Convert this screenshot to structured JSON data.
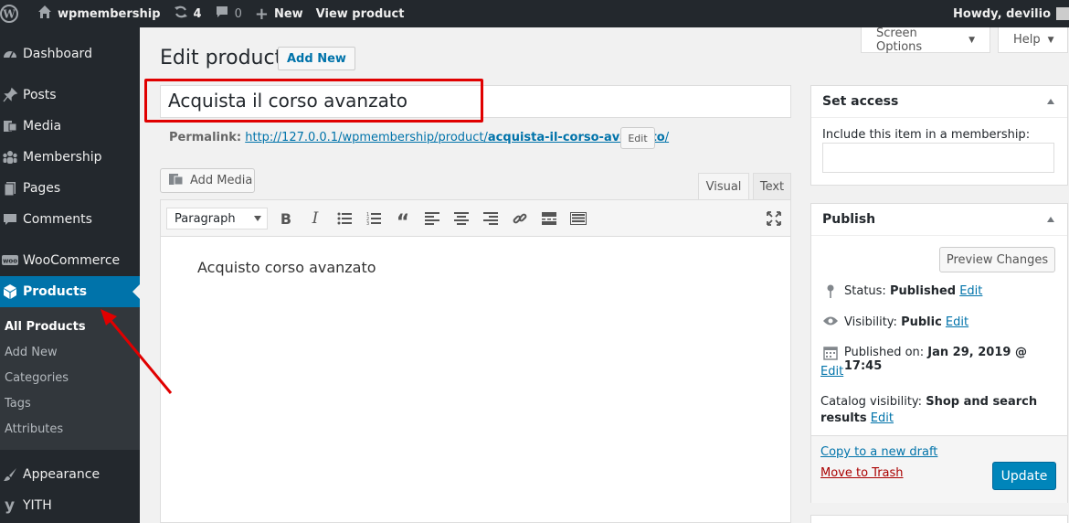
{
  "adminbar": {
    "site_name": "wpmembership",
    "updates_count": "4",
    "comments_count": "0",
    "new_label": "New",
    "view_label": "View product",
    "howdy": "Howdy, devilio"
  },
  "sidebar": {
    "items": [
      {
        "label": "Dashboard",
        "icon": "dashboard-icon"
      },
      {
        "label": "Posts",
        "icon": "pushpin-icon"
      },
      {
        "label": "Media",
        "icon": "media-icon"
      },
      {
        "label": "Membership",
        "icon": "groups-icon"
      },
      {
        "label": "Pages",
        "icon": "pages-icon"
      },
      {
        "label": "Comments",
        "icon": "comment-icon"
      },
      {
        "label": "WooCommerce",
        "icon": "woo-icon"
      },
      {
        "label": "Products",
        "icon": "box-icon"
      },
      {
        "label": "Appearance",
        "icon": "brush-icon"
      },
      {
        "label": "YITH",
        "icon": "yith-icon"
      }
    ],
    "submenu": [
      "All Products",
      "Add New",
      "Categories",
      "Tags",
      "Attributes"
    ]
  },
  "header": {
    "title": "Edit product",
    "add_new": "Add New",
    "screen_options": "Screen Options",
    "help": "Help"
  },
  "editor": {
    "post_title": "Acquista il corso avanzato",
    "permalink_label": "Permalink:",
    "permalink_base": "http://127.0.0.1/wpmembership/product/",
    "permalink_slug": "acquista-il-corso-avanzato",
    "permalink_end": "/",
    "permalink_edit": "Edit",
    "add_media": "Add Media",
    "tab_visual": "Visual",
    "tab_text": "Text",
    "format": "Paragraph",
    "content": "Acquisto corso avanzato"
  },
  "access": {
    "title": "Set access",
    "label": "Include this item in a membership:"
  },
  "publish": {
    "title": "Publish",
    "preview": "Preview Changes",
    "status_label": "Status:",
    "status_value": "Published",
    "visibility_label": "Visibility:",
    "visibility_value": "Public",
    "published_label": "Published on:",
    "published_value": "Jan 29, 2019 @ 17:45",
    "catalog_label": "Catalog visibility:",
    "catalog_value_1": "Shop and search",
    "catalog_value_2": "results",
    "edit": "Edit",
    "copy_draft": "Copy to a new draft",
    "trash": "Move to Trash",
    "update": "Update"
  },
  "colors": {
    "admin_dark": "#23282d",
    "accent": "#0073aa",
    "highlight": "#e00000"
  }
}
